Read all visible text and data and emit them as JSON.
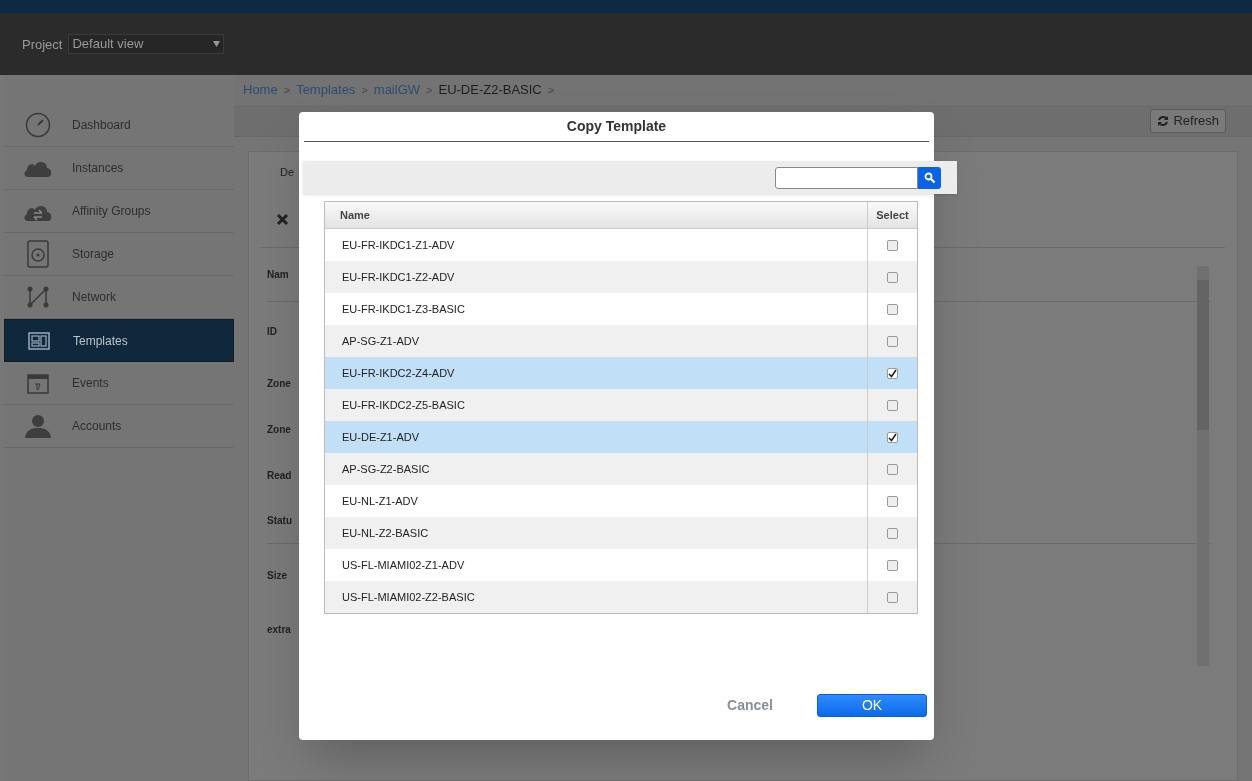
{
  "header": {
    "project_label": "Project",
    "project_select": "Default view"
  },
  "sidebar": {
    "items": [
      {
        "label": "Dashboard",
        "kind": "gauge",
        "selected": false
      },
      {
        "label": "Instances",
        "kind": "cloud",
        "selected": false
      },
      {
        "label": "Affinity Groups",
        "kind": "cloud-arrows",
        "selected": false
      },
      {
        "label": "Storage",
        "kind": "disk",
        "selected": false
      },
      {
        "label": "Network",
        "kind": "network",
        "selected": false
      },
      {
        "label": "Templates",
        "kind": "template",
        "selected": true
      },
      {
        "label": "Events",
        "kind": "calendar",
        "selected": false
      },
      {
        "label": "Accounts",
        "kind": "person",
        "selected": false
      }
    ]
  },
  "breadcrumb": {
    "separator": ">",
    "items": [
      "Home",
      "Templates",
      "mailGW",
      "EU-DE-Z2-BASIC"
    ]
  },
  "toolbar": {
    "refresh": "Refresh"
  },
  "detail": {
    "tab": "De",
    "labels": [
      "Nam",
      "ID",
      "Zone",
      "Zone",
      "Read",
      "Statu",
      "Size",
      "extra"
    ]
  },
  "dialog": {
    "title": "Copy Template",
    "columns": [
      "Name",
      "Select"
    ],
    "rows": [
      {
        "name": "EU-FR-IKDC1-Z1-ADV",
        "selected": false
      },
      {
        "name": "EU-FR-IKDC1-Z2-ADV",
        "selected": false
      },
      {
        "name": "EU-FR-IKDC1-Z3-BASIC",
        "selected": false
      },
      {
        "name": "AP-SG-Z1-ADV",
        "selected": false
      },
      {
        "name": "EU-FR-IKDC2-Z4-ADV",
        "selected": true
      },
      {
        "name": "EU-FR-IKDC2-Z5-BASIC",
        "selected": false
      },
      {
        "name": "EU-DE-Z1-ADV",
        "selected": true
      },
      {
        "name": "AP-SG-Z2-BASIC",
        "selected": false
      },
      {
        "name": "EU-NL-Z1-ADV",
        "selected": false
      },
      {
        "name": "EU-NL-Z2-BASIC",
        "selected": false
      },
      {
        "name": "US-FL-MIAMI02-Z1-ADV",
        "selected": false
      },
      {
        "name": "US-FL-MIAMI02-Z2-BASIC",
        "selected": false
      }
    ],
    "cancel": "Cancel",
    "ok": "OK"
  }
}
